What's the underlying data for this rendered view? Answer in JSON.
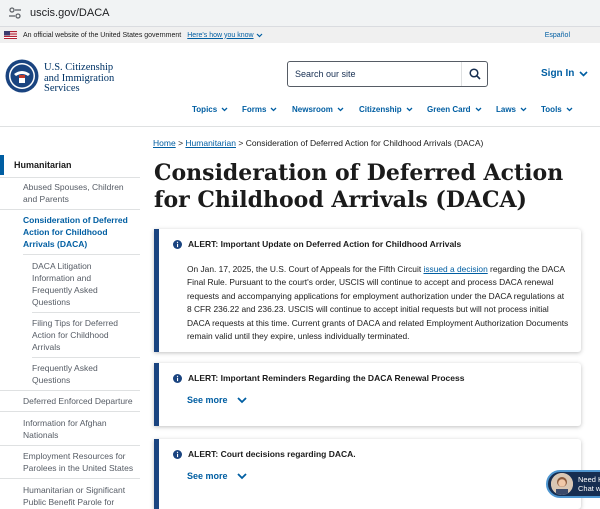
{
  "browser": {
    "url": "uscis.gov/DACA"
  },
  "gov_banner": {
    "text": "An official website of the United States government",
    "how_link": "Here's how you know",
    "espanol": "Español"
  },
  "header": {
    "agency_line1": "U.S. Citizenship",
    "agency_line2": "and Immigration",
    "agency_line3": "Services",
    "search_placeholder": "Search our site",
    "sign_in": "Sign In"
  },
  "nav": [
    "Topics",
    "Forms",
    "Newsroom",
    "Citizenship",
    "Green Card",
    "Laws",
    "Tools"
  ],
  "breadcrumb": {
    "home": "Home",
    "parent": "Humanitarian",
    "current": "Consideration of Deferred Action for Childhood Arrivals (DACA)",
    "sep": ">"
  },
  "sidebar": {
    "heading": "Humanitarian",
    "items": [
      {
        "label": "Abused Spouses, Children and Parents"
      },
      {
        "label": "Consideration of Deferred Action for Childhood Arrivals (DACA)"
      },
      {
        "label": "DACA Litigation Information and Frequently Asked Questions"
      },
      {
        "label": "Filing Tips for Deferred Action for Childhood Arrivals"
      },
      {
        "label": "Frequently Asked Questions"
      },
      {
        "label": "Deferred Enforced Departure"
      },
      {
        "label": "Information for Afghan Nationals"
      },
      {
        "label": "Employment Resources for Parolees in the United States"
      },
      {
        "label": "Humanitarian or Significant Public Benefit Parole for"
      }
    ]
  },
  "page_title": "Consideration of Deferred Action for Childhood Arrivals (DACA)",
  "alerts": [
    {
      "heading": "ALERT: Important Update on Deferred Action for Childhood Arrivals",
      "body_pre": "On Jan. 17, 2025, the U.S. Court of Appeals for the Fifth Circuit ",
      "body_link": "issued a decision",
      "body_post": " regarding the DACA Final Rule. Pursuant to the court's order, USCIS will continue to accept and process DACA renewal requests and accompanying applications for employment authorization under the DACA regulations at 8 CFR 236.22 and 236.23. USCIS will continue to accept initial requests but will not process initial DACA requests at this time. Current grants of DACA and related Employment Authorization Documents remain valid until they expire, unless individually terminated."
    },
    {
      "heading": "ALERT: Important Reminders Regarding the DACA Renewal Process",
      "see_more": "See more"
    },
    {
      "heading": "ALERT: Court decisions regarding DACA.",
      "see_more": "See more"
    }
  ],
  "chat": {
    "line1": "Need H",
    "line2": "Chat w"
  },
  "colors": {
    "link": "#005ea2",
    "alert_border": "#1a4480",
    "agency": "#003366"
  }
}
